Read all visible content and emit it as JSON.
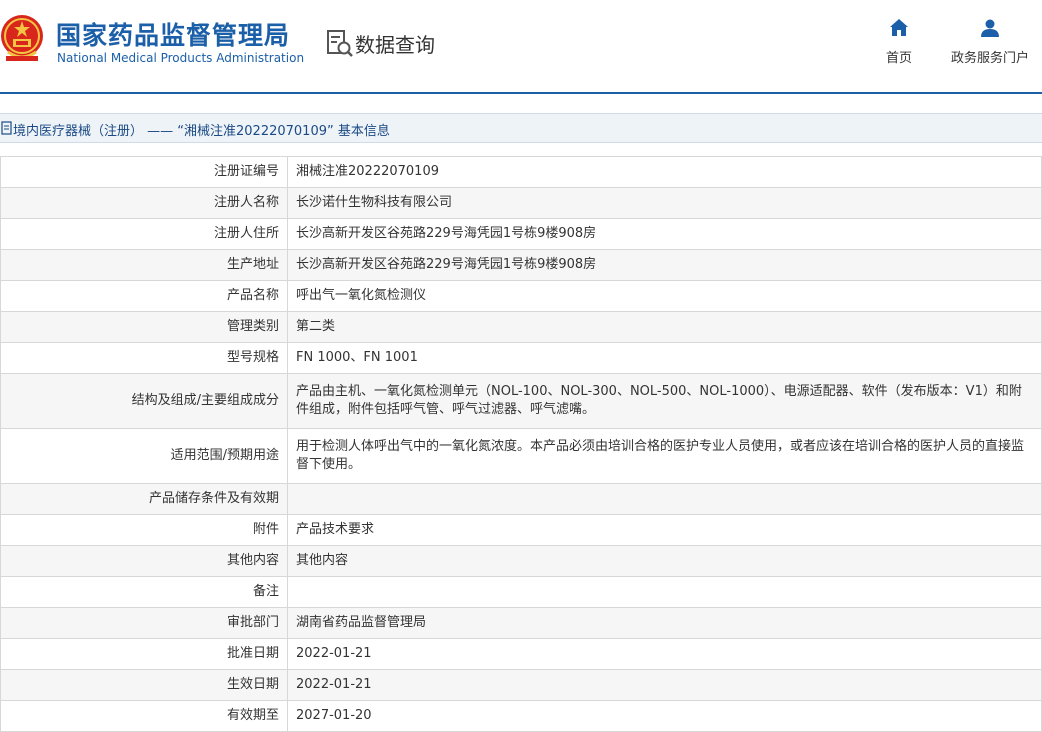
{
  "header": {
    "site_name_cn": "国家药品监督管理局",
    "site_name_en": "National Medical Products Administration",
    "data_query": "数据查询",
    "nav": {
      "home": "首页",
      "portal": "政务服务门户"
    },
    "brand_color": "#1b5fa8"
  },
  "title_bar": {
    "text": "境内医疗器械（注册） —— “湘械注准20222070109” 基本信息"
  },
  "rows": [
    {
      "label": "注册证编号",
      "value": "湘械注准20222070109"
    },
    {
      "label": "注册人名称",
      "value": "长沙诺什生物科技有限公司"
    },
    {
      "label": "注册人住所",
      "value": "长沙高新开发区谷苑路229号海凭园1号栋9楼908房"
    },
    {
      "label": "生产地址",
      "value": "长沙高新开发区谷苑路229号海凭园1号栋9楼908房"
    },
    {
      "label": "产品名称",
      "value": "呼出气一氧化氮检测仪"
    },
    {
      "label": "管理类别",
      "value": "第二类"
    },
    {
      "label": "型号规格",
      "value": "FN 1000、FN 1001"
    },
    {
      "label": "结构及组成/主要组成成分",
      "value": "产品由主机、一氧化氮检测单元（NOL-100、NOL-300、NOL-500、NOL-1000）、电源适配器、软件（发布版本：V1）和附件组成，附件包括呼气管、呼气过滤器、呼气滤嘴。"
    },
    {
      "label": "适用范围/预期用途",
      "value": "用于检测人体呼出气中的一氧化氮浓度。本产品必须由培训合格的医护专业人员使用，或者应该在培训合格的医护人员的直接监督下使用。"
    },
    {
      "label": "产品储存条件及有效期",
      "value": ""
    },
    {
      "label": "附件",
      "value": "产品技术要求"
    },
    {
      "label": "其他内容",
      "value": "其他内容"
    },
    {
      "label": "备注",
      "value": ""
    },
    {
      "label": "审批部门",
      "value": "湖南省药品监督管理局"
    },
    {
      "label": "批准日期",
      "value": "2022-01-21"
    },
    {
      "label": "生效日期",
      "value": "2022-01-21"
    },
    {
      "label": "有效期至",
      "value": "2027-01-20"
    }
  ]
}
